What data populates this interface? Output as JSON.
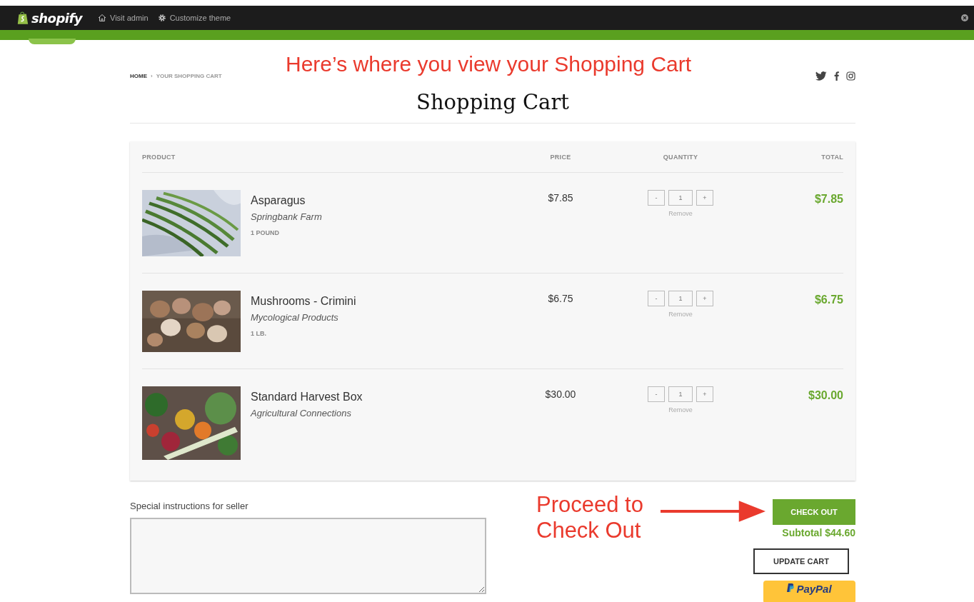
{
  "admin_bar": {
    "brand": "shopify",
    "links": [
      {
        "kind": "home",
        "label": "Visit admin"
      },
      {
        "kind": "gear",
        "label": "Customize theme"
      }
    ]
  },
  "breadcrumb": [
    {
      "label": "HOME",
      "current": false
    },
    {
      "label": "YOUR SHOPPING CART",
      "current": true
    }
  ],
  "separator": "›",
  "annotations": [
    {
      "text": "Here’s where you view your Shopping Cart"
    },
    {
      "text": "Proceed to\nCheck Out"
    }
  ],
  "social": [
    {
      "kind": "twitter"
    },
    {
      "kind": "facebook"
    },
    {
      "kind": "instagram"
    }
  ],
  "page_title": "Shopping Cart",
  "cart": {
    "columns": [
      "PRODUCT",
      "PRICE",
      "QUANTITY",
      "TOTAL"
    ],
    "items": [
      {
        "name": "Asparagus",
        "vendor": "Springbank Farm",
        "variant": "1 POUND",
        "price": "$7.85",
        "minus": "-",
        "quantity": "1",
        "plus": "+",
        "remove": "Remove",
        "total": "$7.85"
      },
      {
        "name": "Mushrooms - Crimini",
        "vendor": "Mycological Products",
        "variant": "1 LB.",
        "price": "$6.75",
        "minus": "-",
        "quantity": "1",
        "plus": "+",
        "remove": "Remove",
        "total": "$6.75"
      },
      {
        "name": "Standard Harvest Box",
        "vendor": "Agricultural Connections",
        "price": "$30.00",
        "minus": "-",
        "quantity": "1",
        "plus": "+",
        "remove": "Remove",
        "total": "$30.00"
      }
    ]
  },
  "notes": {
    "label": "Special instructions for seller"
  },
  "checkout": {
    "button": "CHECK OUT",
    "subtotal": "Subtotal $44.60",
    "update": "UPDATE CART",
    "paypal": "PayPal"
  }
}
